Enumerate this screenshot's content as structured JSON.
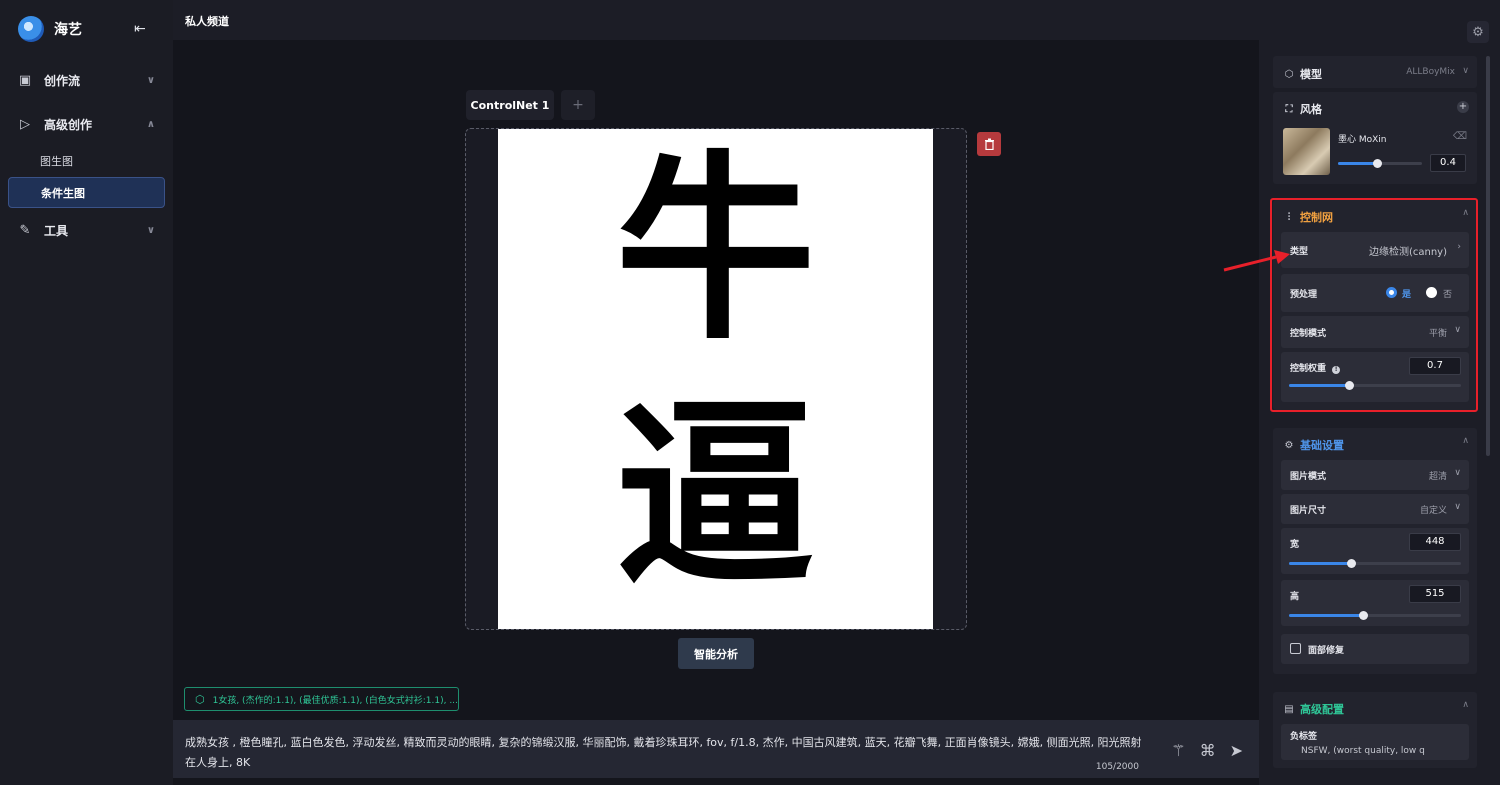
{
  "sidebar": {
    "brand": "海艺",
    "items": [
      {
        "label": "创作流"
      },
      {
        "label": "高级创作"
      },
      {
        "label": "工具"
      }
    ],
    "sub_items": [
      {
        "label": "图生图"
      },
      {
        "label": "条件生图"
      }
    ]
  },
  "topbar": {
    "title": "私人频道"
  },
  "canvas": {
    "tab_label": "ControlNet 1",
    "add_label": "+",
    "image_text": {
      "line1": "牛",
      "line2": "逼"
    },
    "analyze_label": "智能分析"
  },
  "tag_chip": {
    "text": "1女孩, (杰作的:1.1), (最佳优质:1.1), (白色女式衬衫:1.1), ..."
  },
  "prompt": {
    "text": "成熟女孩 , 橙色瞳孔, 蓝白色发色, 浮动发丝, 精致而灵动的眼睛, 复杂的锦缎汉服, 华丽配饰, 戴着珍珠耳环, fov, f/1.8, 杰作, 中国古风建筑, 蓝天, 花瓣飞舞, 正面肖像镜头, 嫦娥, 侧面光照, 阳光照射在人身上, 8K",
    "counter": "105/2000"
  },
  "right_panel": {
    "model": {
      "label": "模型",
      "value": "ALLBoyMix"
    },
    "style": {
      "label": "风格",
      "item_name": "墨心 MoXin",
      "weight": "0.4",
      "weight_fraction": 0.46
    },
    "controlnet": {
      "label": "控制网",
      "type_label": "类型",
      "type_value": "边缘检测(canny)",
      "preprocess_label": "预处理",
      "yes_label": "是",
      "no_label": "否",
      "mode_label": "控制模式",
      "mode_value": "平衡",
      "weight_label": "控制权重",
      "weight_value": "0.7",
      "weight_fraction": 0.35
    },
    "basic": {
      "label": "基础设置",
      "image_mode_label": "图片模式",
      "image_mode_value": "超清",
      "image_size_label": "图片尺寸",
      "image_size_value": "自定义",
      "width_label": "宽",
      "width_value": "448",
      "width_fraction": 0.36,
      "height_label": "高",
      "height_value": "515",
      "height_fraction": 0.43,
      "face_fix_label": "面部修复"
    },
    "advanced": {
      "label": "高级配置",
      "negative_label": "负标签",
      "negative_preview": "NSFW, (worst quality, low q"
    }
  },
  "colors": {
    "accent_blue": "#3a86e8",
    "tag_green": "#2fc596",
    "highlight_red": "#e8202a",
    "controlnet_orange": "#f0a040"
  }
}
